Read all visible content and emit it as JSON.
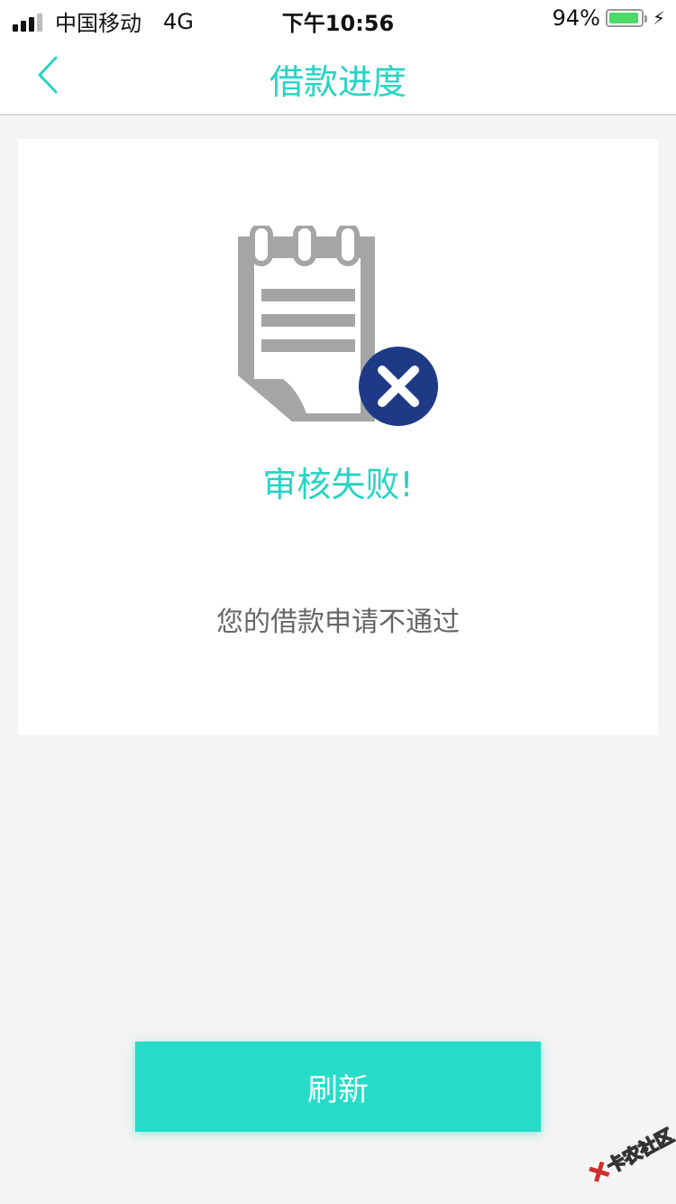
{
  "status_bar": {
    "carrier": "中国移动",
    "network": "4G",
    "time": "下午10:56",
    "battery_percent": "94%",
    "battery_level": 0.94,
    "battery_color": "#4cd964"
  },
  "nav": {
    "title": "借款进度",
    "back_icon": "chevron-left-icon",
    "accent_color": "#26d4c4"
  },
  "result": {
    "icon": "notepad-failed-icon",
    "title": "审核失败!",
    "message": "您的借款申请不通过"
  },
  "actions": {
    "refresh_label": "刷新",
    "button_color": "#26dcc8"
  },
  "watermark": {
    "text": "卡农社区"
  }
}
